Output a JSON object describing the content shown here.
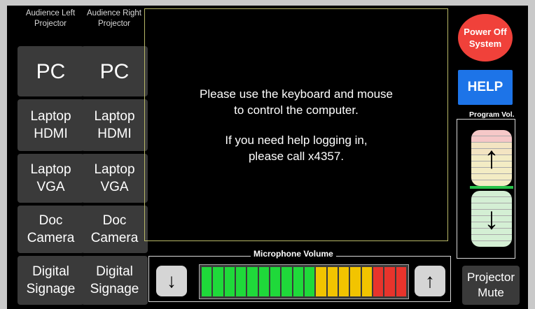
{
  "left_column": {
    "header": "Audience Left\nProjector",
    "buttons": [
      "PC",
      "Laptop\nHDMI",
      "Laptop\nVGA",
      "Doc\nCamera",
      "Digital\nSignage"
    ]
  },
  "right_column": {
    "header": "Audience Right\nProjector",
    "buttons": [
      "PC",
      "Laptop\nHDMI",
      "Laptop\nVGA",
      "Doc\nCamera",
      "Digital\nSignage"
    ]
  },
  "message": {
    "line1": "Please use the keyboard and mouse\nto control the computer.",
    "line2": "If you need help logging in,\nplease call x4357."
  },
  "power_button": "Power Off\nSystem",
  "help_button": "HELP",
  "program_volume": {
    "label": "Program Vol.",
    "up_icon": "arrow-up-icon",
    "down_icon": "arrow-down-icon"
  },
  "microphone_volume": {
    "label": "Microphone Volume",
    "segments": [
      "green",
      "green",
      "green",
      "green",
      "green",
      "green",
      "green",
      "green",
      "green",
      "green",
      "yellow",
      "yellow",
      "yellow",
      "yellow",
      "yellow",
      "red",
      "red",
      "red"
    ],
    "level": 1.0
  },
  "projector_mute": "Projector\nMute",
  "colors": {
    "green": "#1fd93a",
    "yellow": "#f2c400",
    "red": "#e8342c",
    "help_blue": "#1d74e8",
    "power_red": "#f0413a"
  }
}
